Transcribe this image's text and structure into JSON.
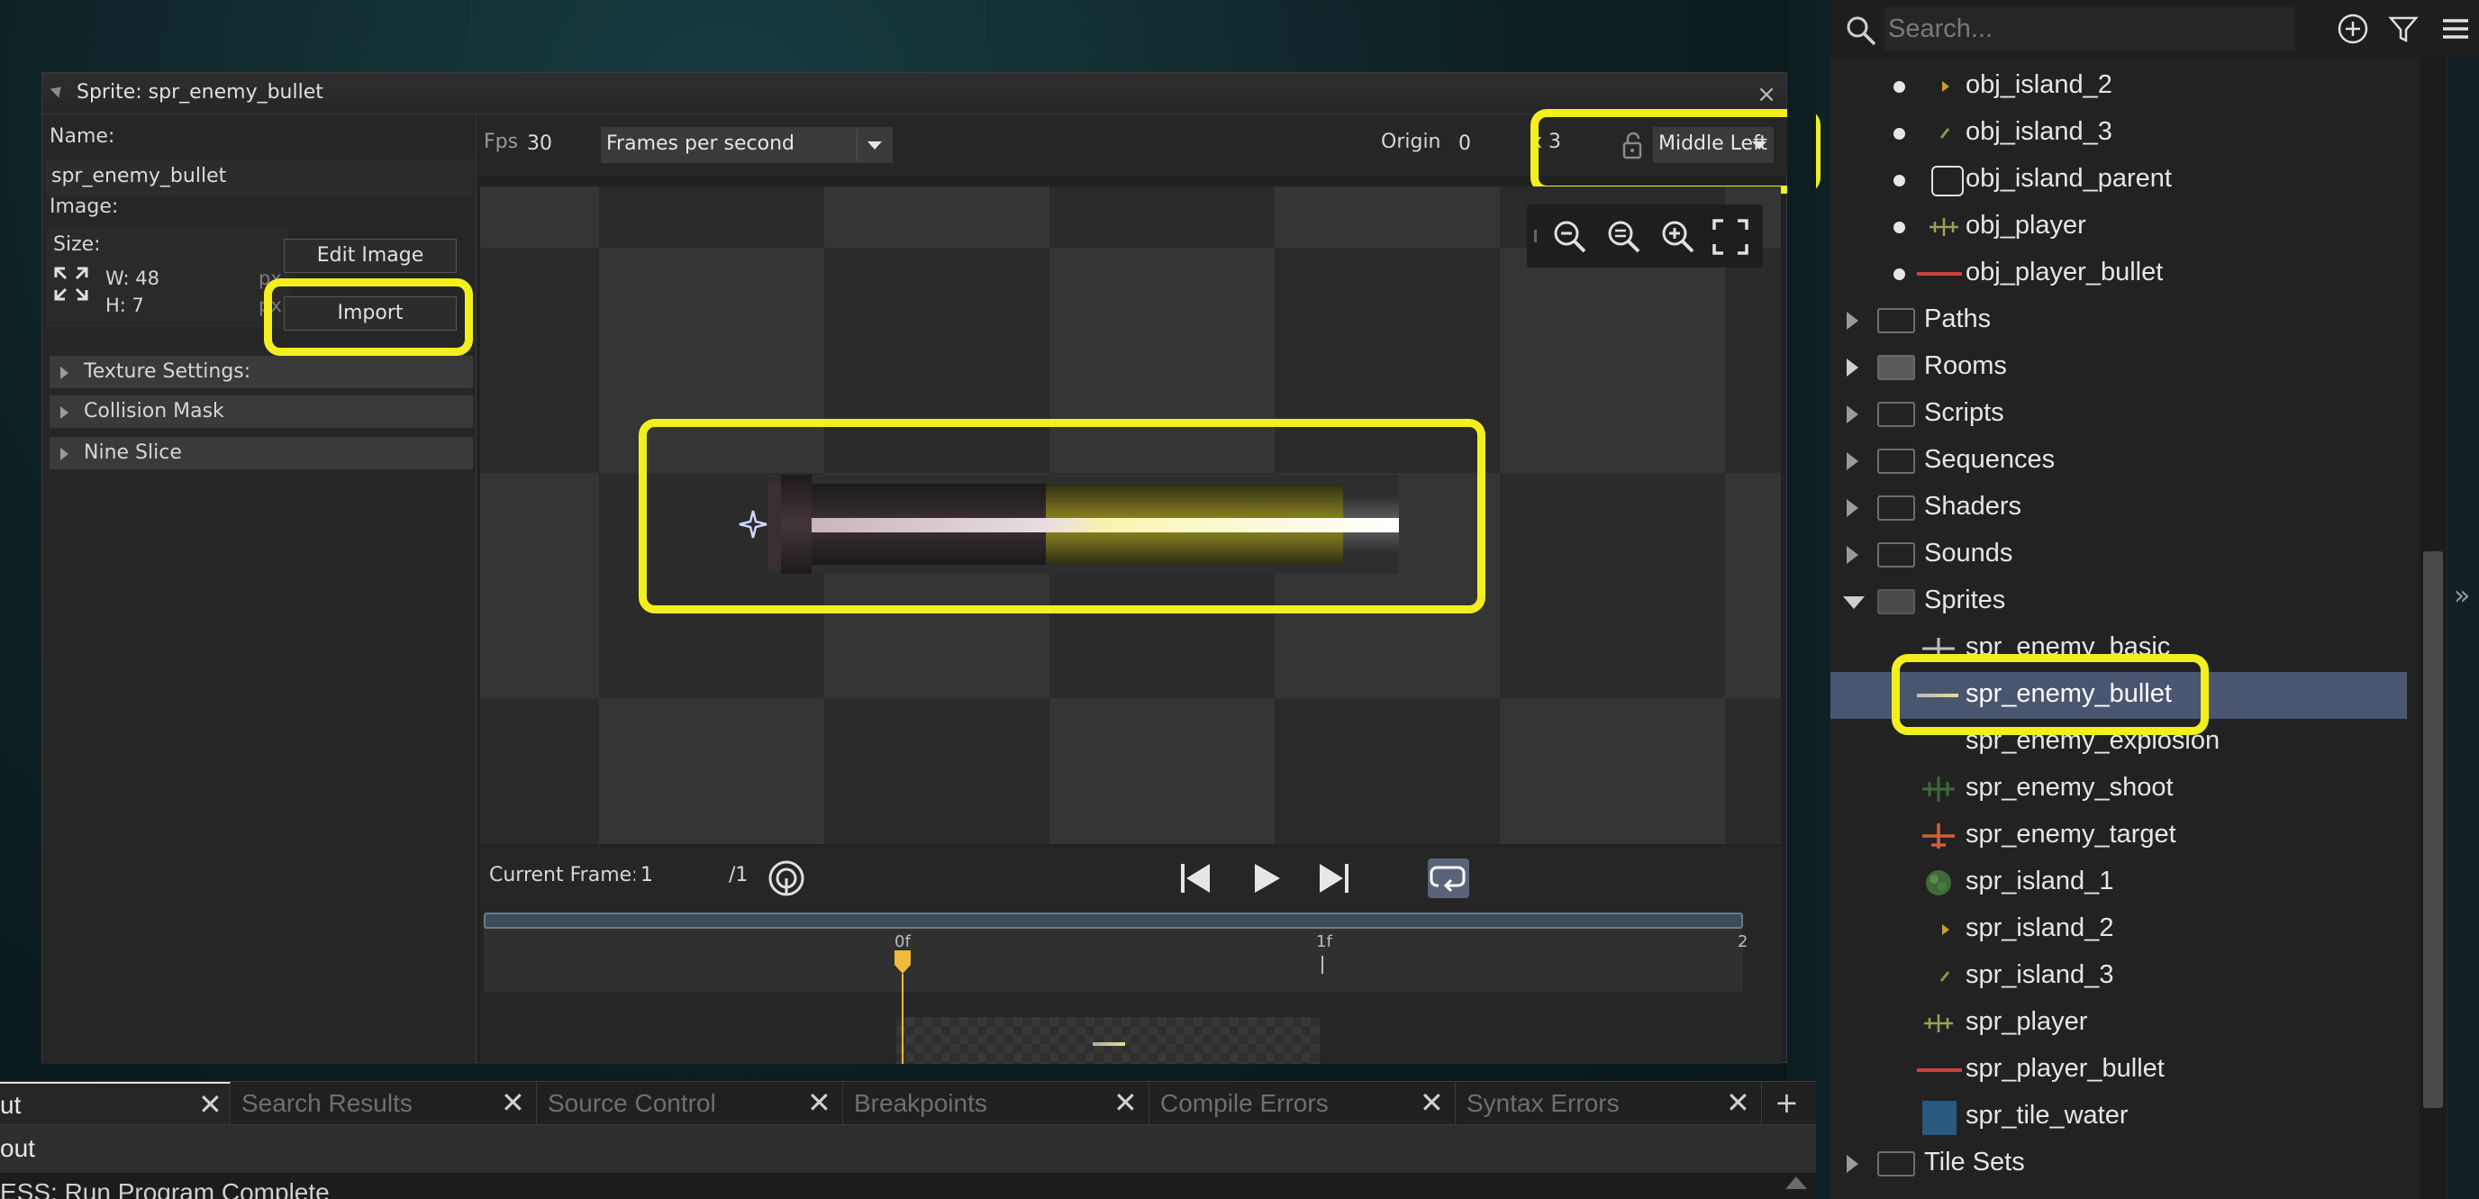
{
  "sprite_window": {
    "title": "Sprite: spr_enemy_bullet",
    "close": "×",
    "name_label": "Name:",
    "name_value": "spr_enemy_bullet",
    "image_label": "Image:",
    "size_label": "Size:",
    "width": "W: 48",
    "height": "H: 7",
    "unit": "px",
    "edit_image": "Edit Image",
    "import": "Import",
    "sections": [
      "Texture Settings:",
      "Collision Mask",
      "Nine Slice"
    ],
    "fps_label": "Fps",
    "fps_value": "30",
    "fps_mode": "Frames per second",
    "origin_label": "Origin",
    "origin_x": "0",
    "origin_y": "x 3",
    "origin_preset": "Middle Left",
    "current_frame_label": "Current Frame:",
    "current_frame": "1",
    "frame_total": "/1",
    "timeline_ticks": [
      "0f",
      "1f",
      "2"
    ]
  },
  "resource_tree": {
    "search_placeholder": "Search...",
    "items": [
      {
        "label": "obj_island_2",
        "kind": "object"
      },
      {
        "label": "obj_island_3",
        "kind": "object"
      },
      {
        "label": "obj_island_parent",
        "kind": "object"
      },
      {
        "label": "obj_player",
        "kind": "object"
      },
      {
        "label": "obj_player_bullet",
        "kind": "object"
      },
      {
        "label": "Paths",
        "kind": "folder"
      },
      {
        "label": "Rooms",
        "kind": "folder"
      },
      {
        "label": "Scripts",
        "kind": "folder"
      },
      {
        "label": "Sequences",
        "kind": "folder"
      },
      {
        "label": "Shaders",
        "kind": "folder"
      },
      {
        "label": "Sounds",
        "kind": "folder"
      },
      {
        "label": "Sprites",
        "kind": "folder-open"
      },
      {
        "label": "spr_enemy_basic",
        "kind": "sprite"
      },
      {
        "label": "spr_enemy_bullet",
        "kind": "sprite-selected"
      },
      {
        "label": "spr_enemy_explosion",
        "kind": "sprite"
      },
      {
        "label": "spr_enemy_shoot",
        "kind": "sprite"
      },
      {
        "label": "spr_enemy_target",
        "kind": "sprite"
      },
      {
        "label": "spr_island_1",
        "kind": "sprite"
      },
      {
        "label": "spr_island_2",
        "kind": "sprite"
      },
      {
        "label": "spr_island_3",
        "kind": "sprite"
      },
      {
        "label": "spr_player",
        "kind": "sprite"
      },
      {
        "label": "spr_player_bullet",
        "kind": "sprite"
      },
      {
        "label": "spr_tile_water",
        "kind": "sprite"
      },
      {
        "label": "Tile Sets",
        "kind": "folder"
      }
    ],
    "collapse_arrow": "»"
  },
  "bottom_panel": {
    "tabs": [
      "ut",
      "Search Results",
      "Source Control",
      "Breakpoints",
      "Compile Errors",
      "Syntax Errors"
    ],
    "add_tab": "+",
    "output_header": "out",
    "output_line": "ESS: Run Program Complete"
  },
  "colors": {
    "highlight": "#f3ef1e",
    "selected_row": "#4a5670",
    "accent_timeline": "#f0b93a"
  }
}
